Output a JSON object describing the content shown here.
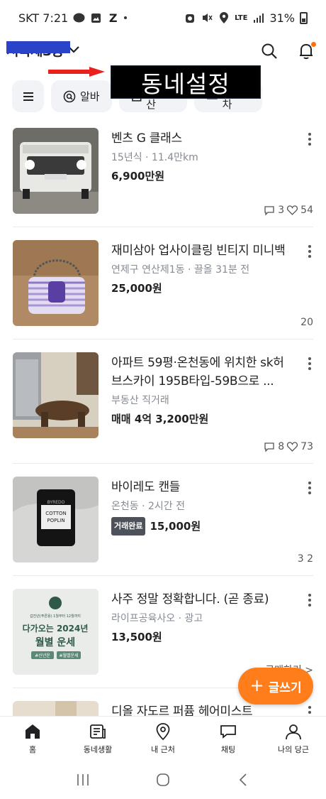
{
  "status_bar": {
    "carrier_time": "SKT 7:21",
    "network": "LTE",
    "battery": "31%"
  },
  "header": {
    "location_label": "서북제3동",
    "location_dropdown_icon": "chevron-down-icon",
    "search_icon": "search-icon",
    "notification_icon": "bell-icon"
  },
  "annotation": {
    "label": "동네설정",
    "arrow_color": "#e8211f"
  },
  "chips": [
    {
      "label": "",
      "icon": "menu-icon"
    },
    {
      "label": "알바",
      "icon": "search-icon"
    },
    {
      "label": "부동산",
      "icon": "home-icon"
    },
    {
      "label": "중고차",
      "icon": "car-icon"
    }
  ],
  "items": [
    {
      "title": "벤츠 G 클래스",
      "meta": "15년식 · 11.4만km",
      "price": "6,900만원",
      "badge": "",
      "comments": "3",
      "likes": "54",
      "chats": ""
    },
    {
      "title": "재미삼아 업사이클링 빈티지 미니백",
      "meta": "연제구 연산제1동 · 끌올 31분 전",
      "price": "25,000원",
      "badge": "",
      "comments": "",
      "likes": "",
      "chats": "20"
    },
    {
      "title": "아파트 59평·온천동에 위치한 sk허브스카이 195B타입-59B으로 ...",
      "meta": "부동산 직거래",
      "price": "매매 4억 3,200만원",
      "badge": "",
      "comments": "8",
      "likes": "73",
      "chats": ""
    },
    {
      "title": "바이레도 캔들",
      "meta": "온천동 · 2시간 전",
      "price": "15,000원",
      "badge": "거래완료",
      "comments": "",
      "likes": "",
      "chats": "3 2"
    },
    {
      "title": "사주 정말 정확합니다. (곧 종료)",
      "meta": "라이프공육사오 · 광고",
      "price": "13,500원",
      "badge": "",
      "comments": "",
      "likes": "",
      "chats": "구매하기 >"
    },
    {
      "title": "디올 자도르 퍼퓸 헤어미스트",
      "meta": "",
      "price": "",
      "badge": "",
      "comments": "",
      "likes": "",
      "chats": ""
    }
  ],
  "thumbs": {
    "candle_brand": "BYREDO",
    "candle_name_1": "COTTON",
    "candle_name_2": "POPLIN",
    "saju_top": "갑진년(푸른용) 1월부터 12월까지",
    "saju_line1": "다가오는 2024년",
    "saju_line2": "월별 운세",
    "saju_tag1": "#신년운",
    "saju_tag2": "#월별운세"
  },
  "fab": {
    "label": "글쓰기"
  },
  "bottom_nav": [
    {
      "label": "홈",
      "icon": "home-icon"
    },
    {
      "label": "동네생활",
      "icon": "community-icon"
    },
    {
      "label": "내 근처",
      "icon": "location-pin-icon"
    },
    {
      "label": "채팅",
      "icon": "chat-icon"
    },
    {
      "label": "나의 당근",
      "icon": "profile-icon"
    }
  ],
  "colors": {
    "accent": "#ff7e1b",
    "redact": "#2a43c9",
    "notification": "#ff6f0f"
  }
}
